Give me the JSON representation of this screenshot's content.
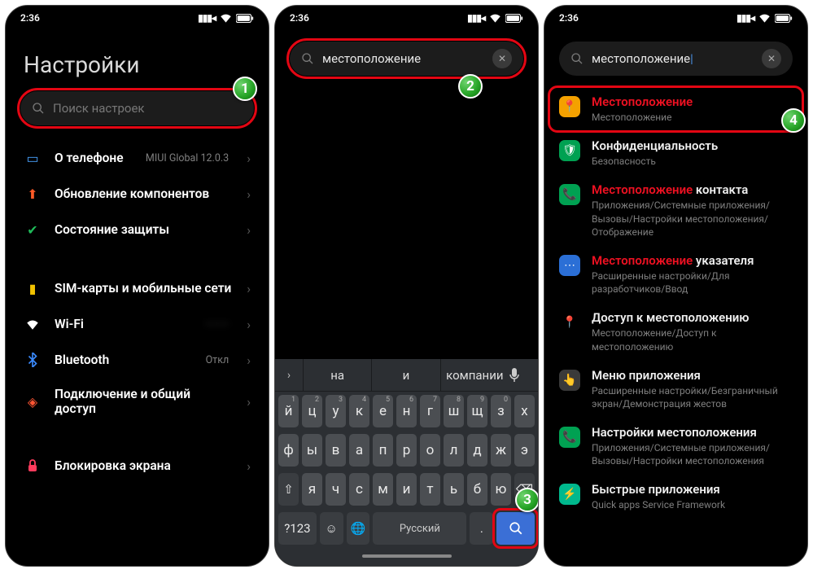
{
  "status": {
    "time": "2:36"
  },
  "panel1": {
    "title": "Настройки",
    "search_placeholder": "Поиск настроек",
    "items": [
      {
        "label": "О телефоне",
        "value": "MIUI Global 12.0.3"
      },
      {
        "label": "Обновление компонентов",
        "value": ""
      },
      {
        "label": "Состояние защиты",
        "value": ""
      },
      {
        "label": "SIM-карты и мобильные сети",
        "value": ""
      },
      {
        "label": "Wi-Fi",
        "value": ""
      },
      {
        "label": "Bluetooth",
        "value": "Откл"
      },
      {
        "label": "Подключение и общий доступ",
        "value": ""
      },
      {
        "label": "Блокировка экрана",
        "value": ""
      }
    ]
  },
  "panel2": {
    "search_value": "местоположение",
    "suggestions": [
      "на",
      "и",
      "компании"
    ],
    "keyboard": {
      "row1": [
        "й",
        "ц",
        "у",
        "к",
        "е",
        "н",
        "г",
        "ш",
        "щ",
        "з",
        "х"
      ],
      "row1_hints": [
        "1",
        "2",
        "3",
        "4",
        "5",
        "6",
        "7",
        "8",
        "9",
        "0",
        ""
      ],
      "row2": [
        "ф",
        "ы",
        "в",
        "а",
        "п",
        "р",
        "о",
        "л",
        "д",
        "ж",
        "э"
      ],
      "row3": [
        "я",
        "ч",
        "с",
        "м",
        "и",
        "т",
        "ь",
        "б",
        "ю"
      ],
      "shift": "⇧",
      "backspace": "⌫",
      "symbols": "?123",
      "emoji": "☺",
      "globe": "🌐",
      "space": "Русский",
      "period": ".",
      "search": "🔍"
    }
  },
  "panel3": {
    "search_value": "местоположение",
    "results": [
      {
        "match": "Местоположение",
        "rest": "",
        "sub": "Местоположение"
      },
      {
        "match": "",
        "rest": "Конфиденциальность",
        "sub": "Безопасность"
      },
      {
        "match": "Местоположение",
        "rest": " контакта",
        "sub": "Приложения/Системные приложения/Вызовы/Настройки местоположения/Отображение"
      },
      {
        "match": "Местоположение",
        "rest": " указателя",
        "sub": "Расширенные настройки/Для разработчиков/Ввод"
      },
      {
        "match": "",
        "rest": "Доступ к местоположению",
        "sub": "Местоположение/Доступ к местоположению"
      },
      {
        "match": "",
        "rest": "Меню приложения",
        "sub": "Расширенные настройки/Безграничный экран/Демонстрация жестов"
      },
      {
        "match": "",
        "rest": "Настройки местоположения",
        "sub": "Приложения/Системные приложения/Вызовы/Настройки местоположения"
      },
      {
        "match": "",
        "rest": "Быстрые приложения",
        "sub": "Quick apps Service Framework"
      }
    ]
  },
  "badges": {
    "b1": "1",
    "b2": "2",
    "b3": "3",
    "b4": "4"
  }
}
